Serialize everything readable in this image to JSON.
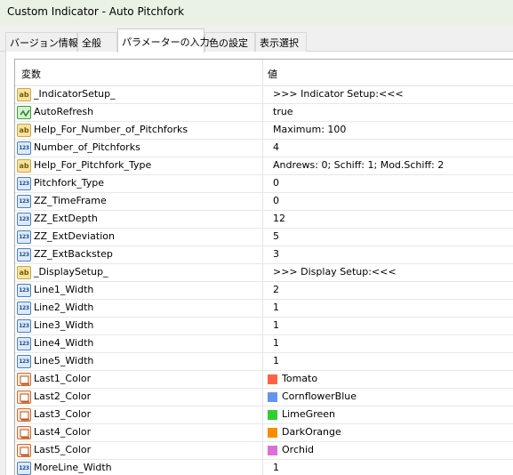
{
  "window": {
    "title": "Custom Indicator - Auto Pitchfork"
  },
  "tabs": [
    {
      "label": "バージョン情報",
      "active": false
    },
    {
      "label": "全般",
      "active": false
    },
    {
      "label": "パラメーターの入力",
      "active": true
    },
    {
      "label": "色の設定",
      "active": false
    },
    {
      "label": "表示選択",
      "active": false
    }
  ],
  "grid": {
    "columns": {
      "variable": "変数",
      "value": "値"
    },
    "rows": [
      {
        "type": "string",
        "name": "_IndicatorSetup_",
        "value": ">>> Indicator Setup:<<<"
      },
      {
        "type": "bool",
        "name": "AutoRefresh",
        "value": "true"
      },
      {
        "type": "string",
        "name": "Help_For_Number_of_Pitchforks",
        "value": "Maximum: 100"
      },
      {
        "type": "int",
        "name": "Number_of_Pitchforks",
        "value": "4"
      },
      {
        "type": "string",
        "name": "Help_For_Pitchfork_Type",
        "value": "Andrews: 0; Schiff: 1; Mod.Schiff: 2"
      },
      {
        "type": "int",
        "name": "Pitchfork_Type",
        "value": "0"
      },
      {
        "type": "int",
        "name": "ZZ_TimeFrame",
        "value": "0"
      },
      {
        "type": "int",
        "name": "ZZ_ExtDepth",
        "value": "12"
      },
      {
        "type": "int",
        "name": "ZZ_ExtDeviation",
        "value": "5"
      },
      {
        "type": "int",
        "name": "ZZ_ExtBackstep",
        "value": "3"
      },
      {
        "type": "string",
        "name": "_DisplaySetup_",
        "value": ">>> Display Setup:<<<"
      },
      {
        "type": "int",
        "name": "Line1_Width",
        "value": "2"
      },
      {
        "type": "int",
        "name": "Line2_Width",
        "value": "1"
      },
      {
        "type": "int",
        "name": "Line3_Width",
        "value": "1"
      },
      {
        "type": "int",
        "name": "Line4_Width",
        "value": "1"
      },
      {
        "type": "int",
        "name": "Line5_Width",
        "value": "1"
      },
      {
        "type": "color",
        "name": "Last1_Color",
        "value": "Tomato",
        "swatch": "#ff6347"
      },
      {
        "type": "color",
        "name": "Last2_Color",
        "value": "CornflowerBlue",
        "swatch": "#6495ed"
      },
      {
        "type": "color",
        "name": "Last3_Color",
        "value": "LimeGreen",
        "swatch": "#32cd32"
      },
      {
        "type": "color",
        "name": "Last4_Color",
        "value": "DarkOrange",
        "swatch": "#ff8c00"
      },
      {
        "type": "color",
        "name": "Last5_Color",
        "value": "Orchid",
        "swatch": "#da70d6"
      },
      {
        "type": "int",
        "name": "MoreLine_Width",
        "value": "1"
      }
    ]
  },
  "icons": {
    "string": {
      "name": "string-param-icon",
      "glyph": "ab"
    },
    "int": {
      "name": "integer-param-icon",
      "glyph": "123"
    },
    "bool": {
      "name": "bool-param-icon"
    },
    "color": {
      "name": "color-param-icon"
    }
  },
  "colors": {
    "titlebar": "#e9f2e5",
    "panel": "#ffffff",
    "border": "#adadad"
  }
}
